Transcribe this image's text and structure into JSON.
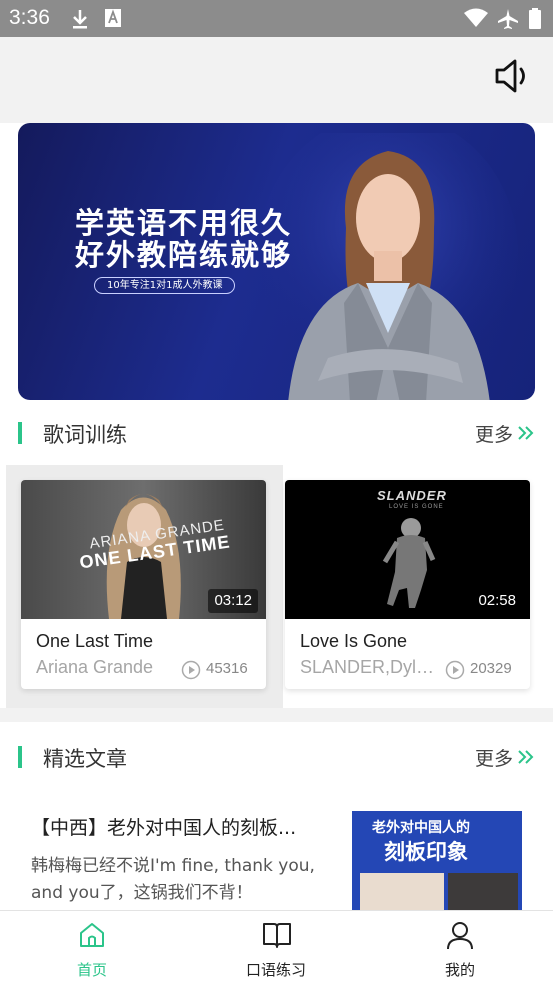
{
  "status_bar": {
    "time": "3:36"
  },
  "banner": {
    "headline_line1": "学英语不用很久",
    "headline_line2": "好外教陪练就够",
    "tagline": "10年专注1对1成人外教课"
  },
  "lyrics_section": {
    "title": "歌词训练",
    "more_label": "更多",
    "songs": [
      {
        "title": "One Last Time",
        "artist": "Ariana Grande",
        "plays": "45316",
        "duration": "03:12",
        "cover_line1": "ARIANA GRANDE",
        "cover_line2": "ONE LAST TIME"
      },
      {
        "title": "Love Is Gone",
        "artist": "SLANDER,Dylan...",
        "plays": "20329",
        "duration": "02:58",
        "cover_line1": "SLANDER",
        "cover_line2": "LOVE IS GONE"
      }
    ]
  },
  "articles_section": {
    "title": "精选文章",
    "more_label": "更多",
    "articles": [
      {
        "title": "【中西】老外对中国人的刻板...",
        "desc_line1": "韩梅梅已经不说I'm fine, thank you,",
        "desc_line2": "and you了，这锅我们不背！",
        "thumb_line1": "老外对中国人的",
        "thumb_line2": "刻板印象"
      }
    ]
  },
  "tabbar": {
    "tabs": [
      {
        "label": "首页",
        "active": true
      },
      {
        "label": "口语练习",
        "active": false
      },
      {
        "label": "我的",
        "active": false
      }
    ]
  },
  "colors": {
    "accent": "#2bc48a",
    "status_bar": "#8c8c8c",
    "banner_bg": "#1d2c8f"
  }
}
